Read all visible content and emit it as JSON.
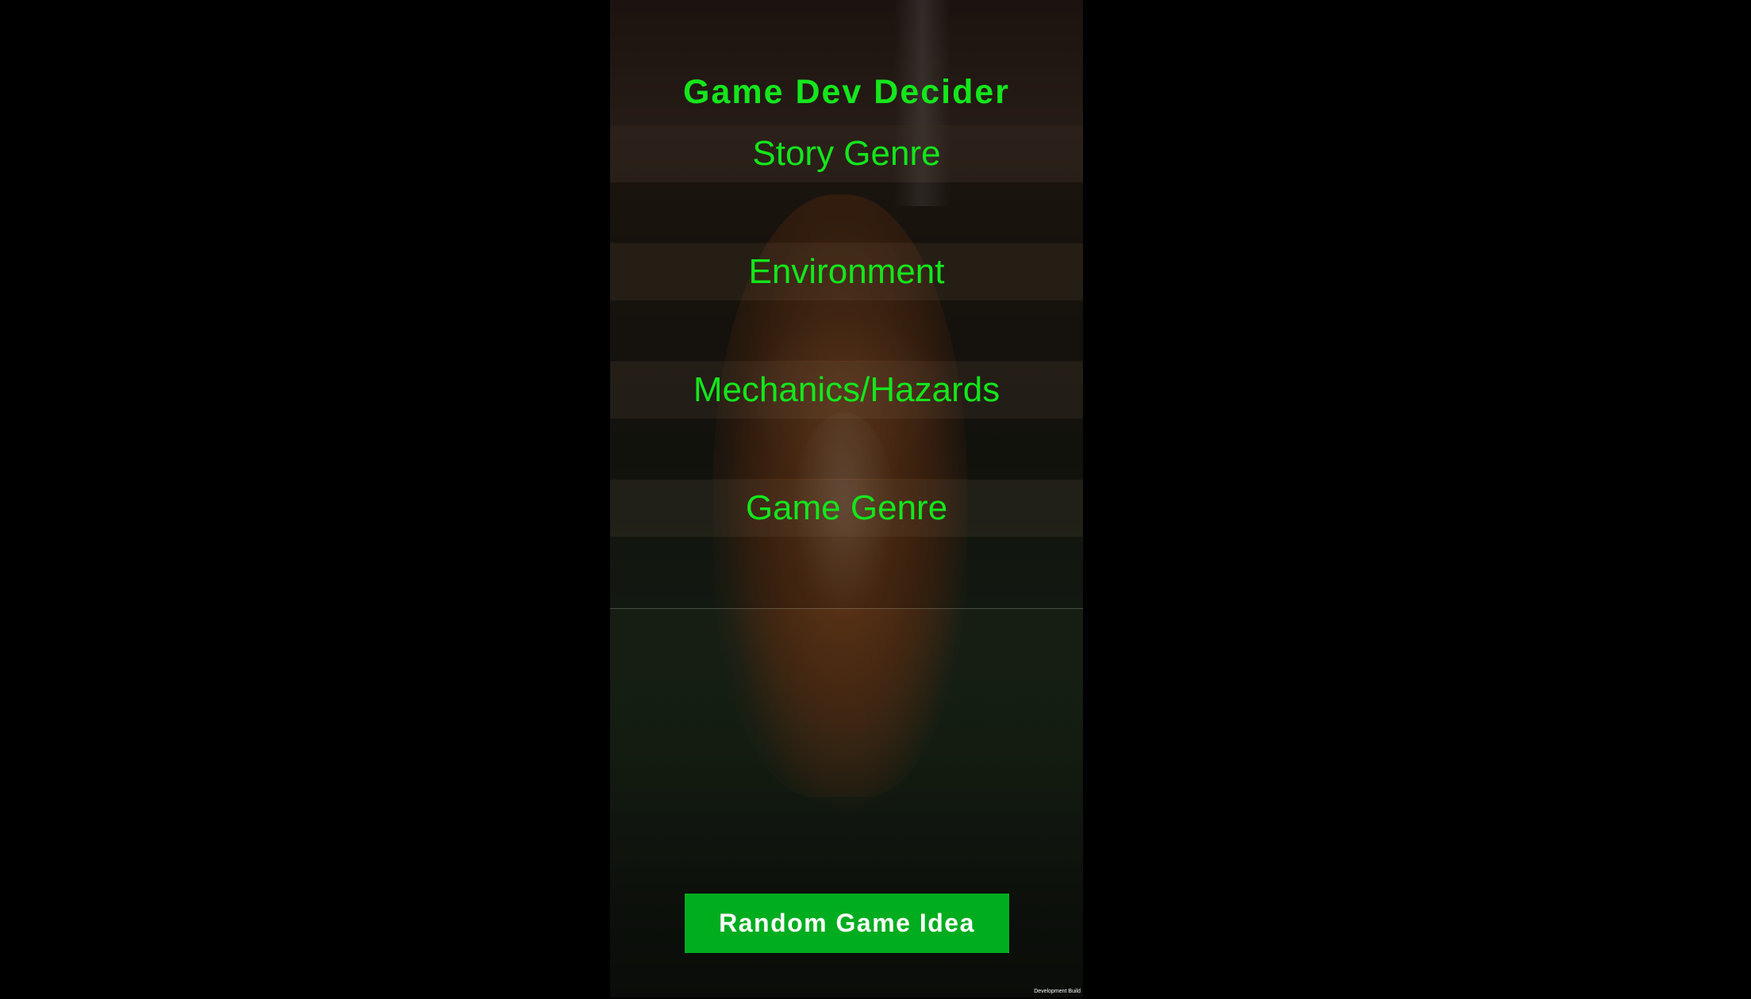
{
  "app": {
    "title": "Game Dev Decider",
    "build_label": "Development Build"
  },
  "categories": [
    {
      "label": "Story Genre",
      "value": ""
    },
    {
      "label": "Environment",
      "value": ""
    },
    {
      "label": "Mechanics/Hazards",
      "value": ""
    },
    {
      "label": "Game Genre",
      "value": ""
    }
  ],
  "actions": {
    "random_label": "Random Game Idea"
  },
  "colors": {
    "accent_text": "#14e61c",
    "button_bg": "#00ad1f",
    "button_text": "#ffffff",
    "letterbox": "#000000"
  },
  "background": {
    "image": "fox-in-forest-photo"
  }
}
